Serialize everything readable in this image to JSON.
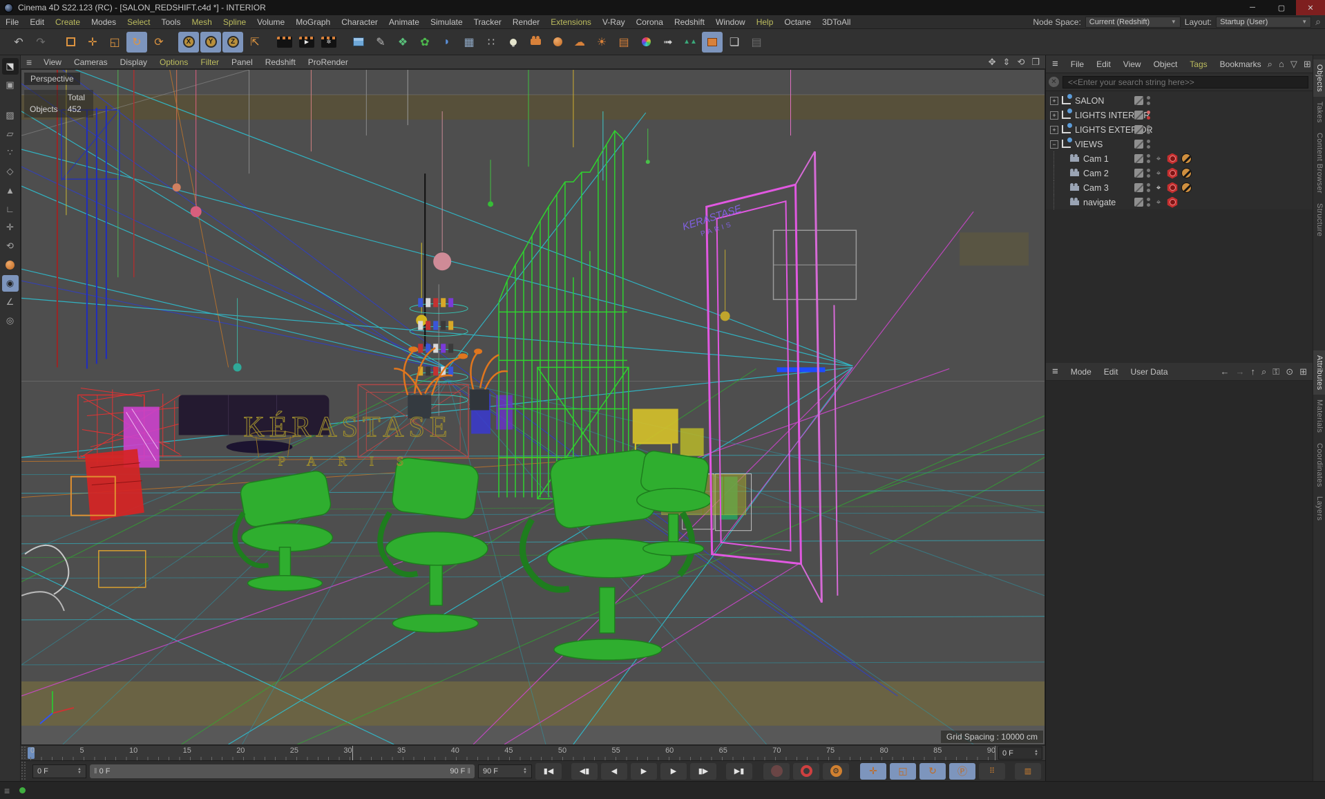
{
  "window": {
    "title": "Cinema 4D S22.123 (RC) - [SALON_REDSHIFT.c4d *] - INTERIOR",
    "minimize_glyph": "─",
    "maximize_glyph": "▢",
    "close_glyph": "✕"
  },
  "menu_bar": {
    "items": [
      "File",
      "Edit",
      "Create",
      "Modes",
      "Select",
      "Tools",
      "Mesh",
      "Spline",
      "Volume",
      "MoGraph",
      "Character",
      "Animate",
      "Simulate",
      "Tracker",
      "Render",
      "Extensions",
      "V-Ray",
      "Corona",
      "Redshift",
      "Window",
      "Help",
      "Octane",
      "3DToAll"
    ]
  },
  "node_space": {
    "label": "Node Space:",
    "value": "Current (Redshift)"
  },
  "layout_selector": {
    "label": "Layout:",
    "value": "Startup (User)"
  },
  "viewport_menu": {
    "items": [
      "View",
      "Cameras",
      "Display",
      "Options",
      "Filter",
      "Panel",
      "Redshift",
      "ProRender"
    ]
  },
  "viewport": {
    "view_label": "Perspective",
    "stats": {
      "header": "Total",
      "row_label": "Objects",
      "value": "452"
    },
    "grid_spacing": "Grid Spacing : 10000 cm",
    "wall_sign_line1": "KÉRASTASE",
    "wall_sign_line2": "P A R I S",
    "neon_sign_line1": "KERASTASE",
    "neon_sign_line2": "PARIS"
  },
  "object_manager": {
    "menu": [
      "File",
      "Edit",
      "View",
      "Object",
      "Tags",
      "Bookmarks"
    ],
    "search_placeholder": "<<Enter your search string here>>",
    "tree": [
      {
        "label": "SALON"
      },
      {
        "label": "LIGHTS INTERIOR"
      },
      {
        "label": "LIGHTS EXTERIOR"
      },
      {
        "label": "VIEWS"
      },
      {
        "label": "Cam 1"
      },
      {
        "label": "Cam 2"
      },
      {
        "label": "Cam 3"
      },
      {
        "label": "navigate"
      }
    ],
    "side_tabs": [
      "Objects",
      "Takes",
      "Content Browser",
      "Structure"
    ]
  },
  "attribute_manager": {
    "menu": [
      "Mode",
      "Edit",
      "User Data"
    ],
    "side_tabs": [
      "Attributes",
      "Materials",
      "Coordinates",
      "Layers"
    ]
  },
  "timeline": {
    "ticks": [
      "0",
      "5",
      "10",
      "15",
      "20",
      "25",
      "30",
      "35",
      "40",
      "45",
      "50",
      "55",
      "60",
      "65",
      "70",
      "75",
      "80",
      "85",
      "90"
    ],
    "frame_field": "0 F"
  },
  "transport": {
    "current_frame": "0 F",
    "range_start": "0 F",
    "range_end": "90 F",
    "end_frame": "90 F"
  },
  "colors": {
    "accent_yellow": "#bcbc5e",
    "selection_blue": "#7d95bd",
    "redshift_tag_red": "#c62f2f",
    "disabled_tag_orange": "#cf8f3f",
    "green_dot": "#3fae3f"
  }
}
